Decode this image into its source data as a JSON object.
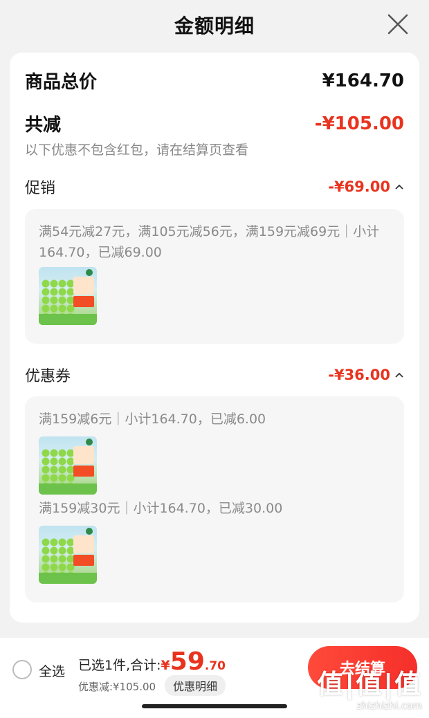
{
  "header": {
    "title": "金额明细",
    "close_icon": "close-icon"
  },
  "summary": {
    "total_label": "商品总价",
    "total_value": "¥164.70",
    "reduce_label": "共减",
    "reduce_value": "-¥105.00",
    "note": "以下优惠不包含红包，请在结算页查看"
  },
  "promotion": {
    "label": "促销",
    "value": "-¥69.00",
    "detail": "满54元减27元，满105元减56元，满159元减69元｜小计164.70，已减69.00"
  },
  "coupon": {
    "label": "优惠券",
    "value": "-¥36.00",
    "items": [
      {
        "text": "满159减6元｜小计164.70，已减6.00"
      },
      {
        "text": "满159减30元｜小计164.70，已减30.00"
      }
    ]
  },
  "bottom": {
    "select_all": "全选",
    "selected_text": "已选1件,合计:",
    "price_symbol": "¥",
    "price_int": "59",
    "price_dec": ".70",
    "discount_text": "优惠减:¥105.00",
    "detail_button": "优惠明细",
    "checkout_button": "去结算",
    "watermark_logo": "值|值|值",
    "watermark_url": "zhizhizhi.com"
  },
  "colors": {
    "accent_red": "#e8341f",
    "background": "#f2f2f2"
  }
}
